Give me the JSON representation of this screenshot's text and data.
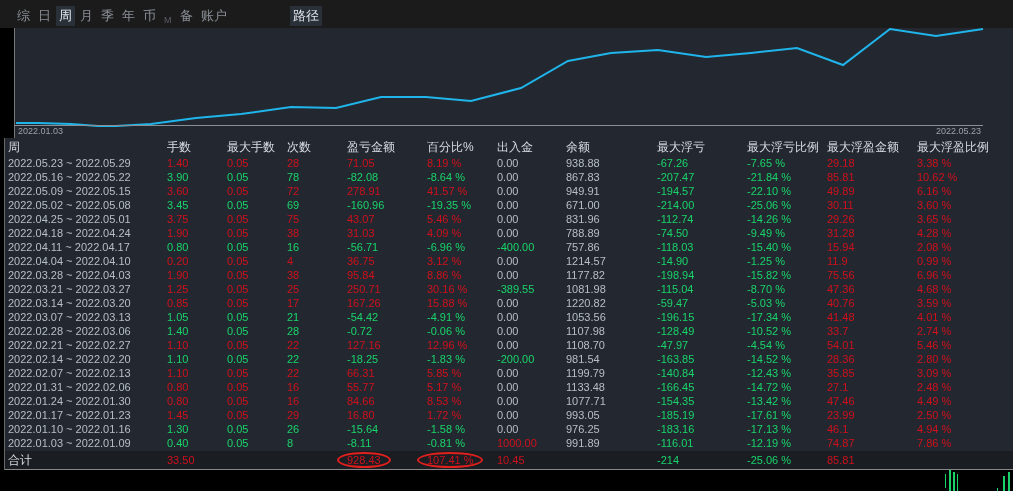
{
  "tabs": [
    {
      "label": "综",
      "selected": false,
      "disabled": false
    },
    {
      "label": "日",
      "selected": false,
      "disabled": false
    },
    {
      "label": "周",
      "selected": true,
      "disabled": false
    },
    {
      "label": "月",
      "selected": false,
      "disabled": false
    },
    {
      "label": "季",
      "selected": false,
      "disabled": false
    },
    {
      "label": "年",
      "selected": false,
      "disabled": false
    },
    {
      "label": "币",
      "selected": false,
      "disabled": false
    },
    {
      "label": "M",
      "selected": false,
      "disabled": true
    },
    {
      "label": "备",
      "selected": false,
      "disabled": false
    },
    {
      "label": "账户",
      "selected": false,
      "disabled": false
    }
  ],
  "path_button": "路径",
  "chart": {
    "start_label": "2022.01.03",
    "end_label": "2022.05.23"
  },
  "table": {
    "columns": [
      "周",
      "手数",
      "最大手数",
      "次数",
      "盈亏金额",
      "百分比%",
      "出入金",
      "余额",
      "最大浮亏",
      "最大浮亏比例",
      "最大浮盈金额",
      "最大浮盈比例"
    ],
    "rows": [
      {
        "profit": true,
        "deposit": false,
        "withdrawal": false,
        "cells": [
          "2022.05.23 ~ 2022.05.29",
          "1.40",
          "0.05",
          "28",
          "71.05",
          "8.19 %",
          "0.00",
          "938.88",
          "-67.26",
          "-7.65 %",
          "29.18",
          "3.38 %"
        ]
      },
      {
        "profit": false,
        "deposit": false,
        "withdrawal": false,
        "cells": [
          "2022.05.16 ~ 2022.05.22",
          "3.90",
          "0.05",
          "78",
          "-82.08",
          "-8.64 %",
          "0.00",
          "867.83",
          "-207.47",
          "-21.84 %",
          "85.81",
          "10.62 %"
        ]
      },
      {
        "profit": true,
        "deposit": false,
        "withdrawal": false,
        "cells": [
          "2022.05.09 ~ 2022.05.15",
          "3.60",
          "0.05",
          "72",
          "278.91",
          "41.57 %",
          "0.00",
          "949.91",
          "-194.57",
          "-22.10 %",
          "49.89",
          "6.16 %"
        ]
      },
      {
        "profit": false,
        "deposit": false,
        "withdrawal": false,
        "cells": [
          "2022.05.02 ~ 2022.05.08",
          "3.45",
          "0.05",
          "69",
          "-160.96",
          "-19.35 %",
          "0.00",
          "671.00",
          "-214.00",
          "-25.06 %",
          "30.11",
          "3.60 %"
        ]
      },
      {
        "profit": true,
        "deposit": false,
        "withdrawal": false,
        "cells": [
          "2022.04.25 ~ 2022.05.01",
          "3.75",
          "0.05",
          "75",
          "43.07",
          "5.46 %",
          "0.00",
          "831.96",
          "-112.74",
          "-14.26 %",
          "29.26",
          "3.65 %"
        ]
      },
      {
        "profit": true,
        "deposit": false,
        "withdrawal": false,
        "cells": [
          "2022.04.18 ~ 2022.04.24",
          "1.90",
          "0.05",
          "38",
          "31.03",
          "4.09 %",
          "0.00",
          "788.89",
          "-74.50",
          "-9.49 %",
          "31.28",
          "4.28 %"
        ]
      },
      {
        "profit": false,
        "deposit": false,
        "withdrawal": true,
        "cells": [
          "2022.04.11 ~ 2022.04.17",
          "0.80",
          "0.05",
          "16",
          "-56.71",
          "-6.96 %",
          "-400.00",
          "757.86",
          "-118.03",
          "-15.40 %",
          "15.94",
          "2.08 %"
        ]
      },
      {
        "profit": true,
        "deposit": false,
        "withdrawal": false,
        "cells": [
          "2022.04.04 ~ 2022.04.10",
          "0.20",
          "0.05",
          "4",
          "36.75",
          "3.12 %",
          "0.00",
          "1214.57",
          "-14.90",
          "-1.25 %",
          "11.9",
          "0.99 %"
        ]
      },
      {
        "profit": true,
        "deposit": false,
        "withdrawal": false,
        "cells": [
          "2022.03.28 ~ 2022.04.03",
          "1.90",
          "0.05",
          "38",
          "95.84",
          "8.86 %",
          "0.00",
          "1177.82",
          "-198.94",
          "-15.82 %",
          "75.56",
          "6.96 %"
        ]
      },
      {
        "profit": true,
        "deposit": false,
        "withdrawal": true,
        "cells": [
          "2022.03.21 ~ 2022.03.27",
          "1.25",
          "0.05",
          "25",
          "250.71",
          "30.16 %",
          "-389.55",
          "1081.98",
          "-115.04",
          "-8.70 %",
          "47.36",
          "4.68 %"
        ]
      },
      {
        "profit": true,
        "deposit": false,
        "withdrawal": false,
        "cells": [
          "2022.03.14 ~ 2022.03.20",
          "0.85",
          "0.05",
          "17",
          "167.26",
          "15.88 %",
          "0.00",
          "1220.82",
          "-59.47",
          "-5.03 %",
          "40.76",
          "3.59 %"
        ]
      },
      {
        "profit": false,
        "deposit": false,
        "withdrawal": false,
        "cells": [
          "2022.03.07 ~ 2022.03.13",
          "1.05",
          "0.05",
          "21",
          "-54.42",
          "-4.91 %",
          "0.00",
          "1053.56",
          "-196.15",
          "-17.34 %",
          "41.48",
          "4.01 %"
        ]
      },
      {
        "profit": false,
        "deposit": false,
        "withdrawal": false,
        "cells": [
          "2022.02.28 ~ 2022.03.06",
          "1.40",
          "0.05",
          "28",
          "-0.72",
          "-0.06 %",
          "0.00",
          "1107.98",
          "-128.49",
          "-10.52 %",
          "33.7",
          "2.74 %"
        ]
      },
      {
        "profit": true,
        "deposit": false,
        "withdrawal": false,
        "cells": [
          "2022.02.21 ~ 2022.02.27",
          "1.10",
          "0.05",
          "22",
          "127.16",
          "12.96 %",
          "0.00",
          "1108.70",
          "-47.97",
          "-4.54 %",
          "54.01",
          "5.46 %"
        ]
      },
      {
        "profit": false,
        "deposit": false,
        "withdrawal": true,
        "cells": [
          "2022.02.14 ~ 2022.02.20",
          "1.10",
          "0.05",
          "22",
          "-18.25",
          "-1.83 %",
          "-200.00",
          "981.54",
          "-163.85",
          "-14.52 %",
          "28.36",
          "2.80 %"
        ]
      },
      {
        "profit": true,
        "deposit": false,
        "withdrawal": false,
        "cells": [
          "2022.02.07 ~ 2022.02.13",
          "1.10",
          "0.05",
          "22",
          "66.31",
          "5.85 %",
          "0.00",
          "1199.79",
          "-140.84",
          "-12.43 %",
          "35.85",
          "3.09 %"
        ]
      },
      {
        "profit": true,
        "deposit": false,
        "withdrawal": false,
        "cells": [
          "2022.01.31 ~ 2022.02.06",
          "0.80",
          "0.05",
          "16",
          "55.77",
          "5.17 %",
          "0.00",
          "1133.48",
          "-166.45",
          "-14.72 %",
          "27.1",
          "2.48 %"
        ]
      },
      {
        "profit": true,
        "deposit": false,
        "withdrawal": false,
        "cells": [
          "2022.01.24 ~ 2022.01.30",
          "0.80",
          "0.05",
          "16",
          "84.66",
          "8.53 %",
          "0.00",
          "1077.71",
          "-154.35",
          "-13.42 %",
          "47.46",
          "4.49 %"
        ]
      },
      {
        "profit": true,
        "deposit": false,
        "withdrawal": false,
        "cells": [
          "2022.01.17 ~ 2022.01.23",
          "1.45",
          "0.05",
          "29",
          "16.80",
          "1.72 %",
          "0.00",
          "993.05",
          "-185.19",
          "-17.61 %",
          "23.99",
          "2.50 %"
        ]
      },
      {
        "profit": false,
        "deposit": false,
        "withdrawal": false,
        "cells": [
          "2022.01.10 ~ 2022.01.16",
          "1.30",
          "0.05",
          "26",
          "-15.64",
          "-1.58 %",
          "0.00",
          "976.25",
          "-183.16",
          "-17.13 %",
          "46.1",
          "4.94 %"
        ]
      },
      {
        "profit": false,
        "deposit": true,
        "withdrawal": false,
        "cells": [
          "2022.01.03 ~ 2022.01.09",
          "0.40",
          "0.05",
          "8",
          "-8.11",
          "-0.81 %",
          "1000.00",
          "991.89",
          "-116.01",
          "-12.19 %",
          "74.87",
          "7.86 %"
        ]
      }
    ],
    "total": {
      "pnl_circled": true,
      "pct_circled": true,
      "cells": [
        "合计",
        "33.50",
        "",
        "",
        "928.43",
        "107.41 %",
        "10.45",
        "",
        "-214",
        "-25.06 %",
        "85.81"
      ]
    }
  }
}
